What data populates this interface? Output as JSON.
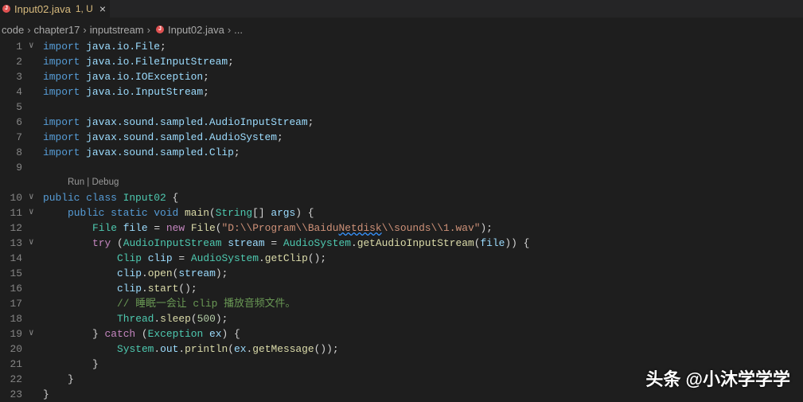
{
  "tab": {
    "title": "Input02.java",
    "status": "1, U",
    "icon": "java-error-icon",
    "close": "×"
  },
  "breadcrumb": [
    "code",
    "chapter17",
    "inputstream",
    "Input02.java",
    "..."
  ],
  "codelens": "Run | Debug",
  "watermark": "头条 @小沐学学学",
  "lines": [
    {
      "n": "1",
      "fold": true,
      "indent": 0,
      "tokens": [
        [
          "import",
          "k"
        ],
        [
          " ",
          "p"
        ],
        [
          "java.io.File",
          "v"
        ],
        [
          ";",
          "p"
        ]
      ]
    },
    {
      "n": "2",
      "indent": 0,
      "tokens": [
        [
          "import",
          "k"
        ],
        [
          " ",
          "p"
        ],
        [
          "java.io.FileInputStream",
          "v"
        ],
        [
          ";",
          "p"
        ]
      ]
    },
    {
      "n": "3",
      "indent": 0,
      "tokens": [
        [
          "import",
          "k"
        ],
        [
          " ",
          "p"
        ],
        [
          "java.io.IOException",
          "v"
        ],
        [
          ";",
          "p"
        ]
      ]
    },
    {
      "n": "4",
      "indent": 0,
      "tokens": [
        [
          "import",
          "k"
        ],
        [
          " ",
          "p"
        ],
        [
          "java.io.InputStream",
          "v"
        ],
        [
          ";",
          "p"
        ]
      ]
    },
    {
      "n": "5",
      "indent": 0,
      "tokens": []
    },
    {
      "n": "6",
      "indent": 0,
      "tokens": [
        [
          "import",
          "k"
        ],
        [
          " ",
          "p"
        ],
        [
          "javax.sound.sampled.AudioInputStream",
          "v"
        ],
        [
          ";",
          "p"
        ]
      ]
    },
    {
      "n": "7",
      "indent": 0,
      "tokens": [
        [
          "import",
          "k"
        ],
        [
          " ",
          "p"
        ],
        [
          "javax.sound.sampled.AudioSystem",
          "v"
        ],
        [
          ";",
          "p"
        ]
      ]
    },
    {
      "n": "8",
      "indent": 0,
      "tokens": [
        [
          "import",
          "k"
        ],
        [
          " ",
          "p"
        ],
        [
          "javax.sound.sampled.Clip",
          "v"
        ],
        [
          ";",
          "p"
        ]
      ]
    },
    {
      "n": "9",
      "indent": 0,
      "tokens": []
    },
    {
      "n": "10",
      "fold": true,
      "lens": true,
      "indent": 0,
      "tokens": [
        [
          "public class ",
          "k"
        ],
        [
          "Input02",
          "t"
        ],
        [
          " {",
          "p"
        ]
      ]
    },
    {
      "n": "11",
      "fold": true,
      "indent": 1,
      "tokens": [
        [
          "public static void ",
          "k"
        ],
        [
          "main",
          "f"
        ],
        [
          "(",
          "p"
        ],
        [
          "String",
          "t"
        ],
        [
          "[] ",
          "p"
        ],
        [
          "args",
          "v"
        ],
        [
          ") {",
          "p"
        ]
      ]
    },
    {
      "n": "12",
      "indent": 2,
      "tokens": [
        [
          "File ",
          "t"
        ],
        [
          "file",
          "v"
        ],
        [
          " = ",
          "p"
        ],
        [
          "new ",
          "c"
        ],
        [
          "File",
          "f"
        ],
        [
          "(",
          "p"
        ],
        [
          "\"D:\\\\Program\\\\Baidu",
          "s"
        ],
        [
          "Netdisk",
          "s sq"
        ],
        [
          "\\\\sounds\\\\1.wav\"",
          "s"
        ],
        [
          ");",
          "p"
        ]
      ]
    },
    {
      "n": "13",
      "fold": true,
      "indent": 2,
      "tokens": [
        [
          "try ",
          "c"
        ],
        [
          "(",
          "p"
        ],
        [
          "AudioInputStream ",
          "t"
        ],
        [
          "stream",
          "v"
        ],
        [
          " = ",
          "p"
        ],
        [
          "AudioSystem",
          "t"
        ],
        [
          ".",
          "p"
        ],
        [
          "getAudioInputStream",
          "f"
        ],
        [
          "(",
          "p"
        ],
        [
          "file",
          "v"
        ],
        [
          ")) {",
          "p"
        ]
      ]
    },
    {
      "n": "14",
      "indent": 3,
      "tokens": [
        [
          "Clip ",
          "t"
        ],
        [
          "clip",
          "v"
        ],
        [
          " = ",
          "p"
        ],
        [
          "AudioSystem",
          "t"
        ],
        [
          ".",
          "p"
        ],
        [
          "getClip",
          "f"
        ],
        [
          "();",
          "p"
        ]
      ]
    },
    {
      "n": "15",
      "indent": 3,
      "tokens": [
        [
          "clip",
          "v"
        ],
        [
          ".",
          "p"
        ],
        [
          "open",
          "f"
        ],
        [
          "(",
          "p"
        ],
        [
          "stream",
          "v"
        ],
        [
          ");",
          "p"
        ]
      ]
    },
    {
      "n": "16",
      "indent": 3,
      "tokens": [
        [
          "clip",
          "v"
        ],
        [
          ".",
          "p"
        ],
        [
          "start",
          "f"
        ],
        [
          "();",
          "p"
        ]
      ]
    },
    {
      "n": "17",
      "indent": 3,
      "tokens": [
        [
          "// 睡眠一会让 clip 播放音频文件。",
          "m"
        ]
      ]
    },
    {
      "n": "18",
      "indent": 3,
      "tokens": [
        [
          "Thread",
          "t"
        ],
        [
          ".",
          "p"
        ],
        [
          "sleep",
          "f"
        ],
        [
          "(",
          "p"
        ],
        [
          "500",
          "n"
        ],
        [
          ");",
          "p"
        ]
      ]
    },
    {
      "n": "19",
      "fold": true,
      "indent": 2,
      "tokens": [
        [
          "} ",
          "p"
        ],
        [
          "catch ",
          "c"
        ],
        [
          "(",
          "p"
        ],
        [
          "Exception ",
          "t"
        ],
        [
          "ex",
          "v"
        ],
        [
          ") {",
          "p"
        ]
      ]
    },
    {
      "n": "20",
      "indent": 3,
      "tokens": [
        [
          "System",
          "t"
        ],
        [
          ".",
          "p"
        ],
        [
          "out",
          "v"
        ],
        [
          ".",
          "p"
        ],
        [
          "println",
          "f"
        ],
        [
          "(",
          "p"
        ],
        [
          "ex",
          "v"
        ],
        [
          ".",
          "p"
        ],
        [
          "getMessage",
          "f"
        ],
        [
          "());",
          "p"
        ]
      ]
    },
    {
      "n": "21",
      "indent": 2,
      "tokens": [
        [
          "}",
          "p"
        ]
      ]
    },
    {
      "n": "22",
      "indent": 1,
      "tokens": [
        [
          "}",
          "p"
        ]
      ]
    },
    {
      "n": "23",
      "indent": 0,
      "tokens": [
        [
          "}",
          "p"
        ]
      ]
    }
  ]
}
